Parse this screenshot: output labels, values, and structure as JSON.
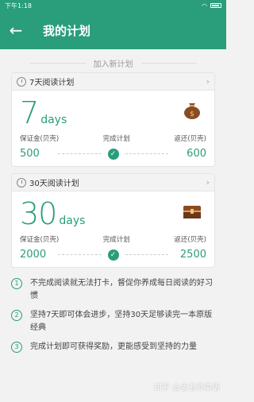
{
  "status": {
    "time": "下午1:18"
  },
  "header": {
    "title": "我的计划"
  },
  "section": {
    "label": "加入新计划"
  },
  "plans": [
    {
      "title": "7天阅读计划",
      "days_number": "7",
      "days_unit": "days",
      "deposit_label": "保证金(贝壳)",
      "complete_label": "完成计划",
      "refund_label": "返还(贝壳)",
      "deposit_value": "500",
      "refund_value": "600"
    },
    {
      "title": "30天阅读计划",
      "days_number": "30",
      "days_unit": "days",
      "deposit_label": "保证金(贝壳)",
      "complete_label": "完成计划",
      "refund_label": "返还(贝壳)",
      "deposit_value": "2000",
      "refund_value": "2500"
    }
  ],
  "tips": [
    {
      "num": "1",
      "text": "不完成阅读就无法打卡，督促你养成每日阅读的好习惯"
    },
    {
      "num": "2",
      "text": "坚持7天即可体会进步，坚持30天足够读完一本原版经典"
    },
    {
      "num": "3",
      "text": "完成计划即可获得奖励，更能感受到坚持的力量"
    }
  ],
  "watermark": "知乎 @孟老师英语"
}
